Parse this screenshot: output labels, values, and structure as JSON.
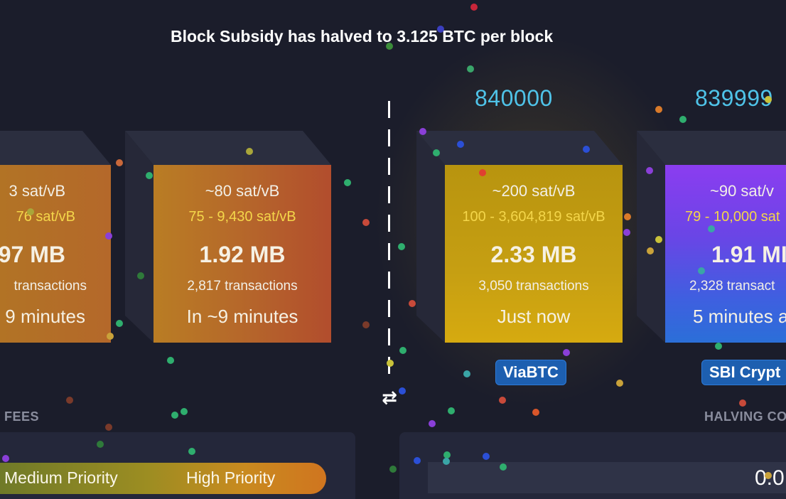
{
  "banner": {
    "text": "Block Subsidy has halved to 3.125 BTC per block"
  },
  "pending_blocks": [
    {
      "fee_median": "3 sat/vB",
      "fee_range": "76 sat/vB",
      "size": "97 MB",
      "transactions": "transactions",
      "eta": "9 minutes"
    },
    {
      "fee_median": "~80 sat/vB",
      "fee_range": "75 - 9,430 sat/vB",
      "size": "1.92 MB",
      "transactions": "2,817 transactions",
      "eta": "In ~9 minutes"
    }
  ],
  "mined_blocks": [
    {
      "height": "840000",
      "fee_median": "~200 sat/vB",
      "fee_range": "100 - 3,604,819 sat/vB",
      "size": "2.33 MB",
      "transactions": "3,050 transactions",
      "time": "Just now",
      "pool": "ViaBTC"
    },
    {
      "height": "839999",
      "fee_median": "~90 sat/v",
      "fee_range": "79 - 10,000 sat",
      "size": "1.91 MI",
      "transactions": "2,328 transact",
      "time": "5 minutes a",
      "pool": "SBI Crypt"
    }
  ],
  "sections": {
    "fees_title": "FEES",
    "halving_title": "HALVING CO"
  },
  "priority": {
    "medium": "Medium Priority",
    "high": "High Priority"
  },
  "countdown": {
    "value": "0.0"
  },
  "icons": {
    "swap": "swap-arrows-icon"
  },
  "colors": {
    "accent_height": "#4fc3e8",
    "fee_range": "#f4d64a",
    "pool_tag": "#1d5fb0",
    "background": "#1b1d2b"
  }
}
